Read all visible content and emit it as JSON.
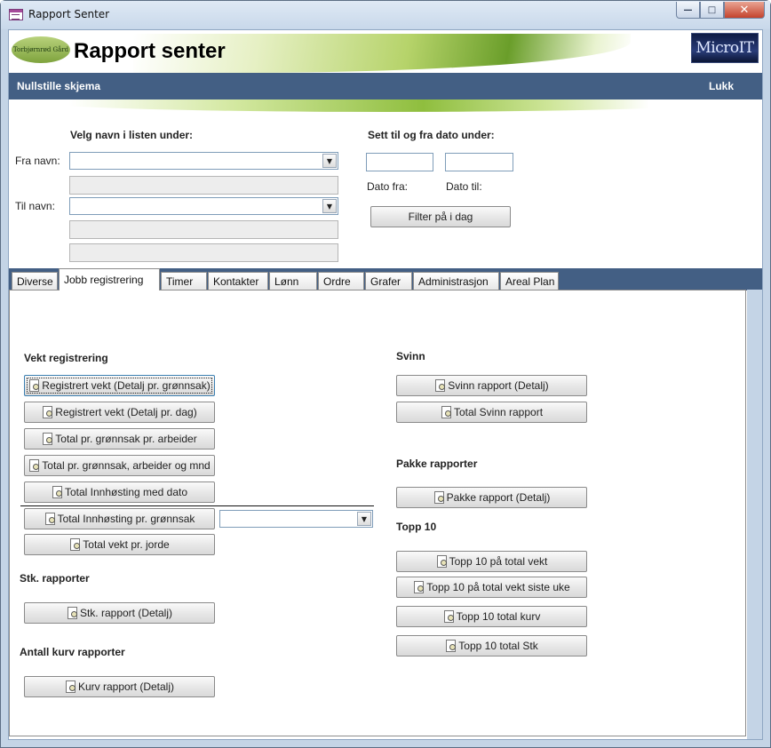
{
  "window": {
    "title": "Rapport Senter",
    "controls": {
      "minimize": "—",
      "maximize": "□",
      "close": "✕"
    }
  },
  "banner": {
    "title": "Rapport senter",
    "logo_text": "Torbjørnrød Gård",
    "brand_text": "MicroIT"
  },
  "nav": {
    "reset": "Nullstille skjema",
    "close": "Lukk"
  },
  "filters": {
    "names_heading": "Velg navn i listen under:",
    "from_name_label": "Fra navn:",
    "to_name_label": "Til navn:",
    "dates_heading": "Sett til og fra dato under:",
    "date_from_label": "Dato fra:",
    "date_to_label": "Dato til:",
    "today_button": "Filter på i dag"
  },
  "tabs": [
    {
      "label": "Diverse",
      "active": false
    },
    {
      "label": "Jobb registrering",
      "active": true
    },
    {
      "label": "Timer",
      "active": false
    },
    {
      "label": "Kontakter",
      "active": false
    },
    {
      "label": "Lønn",
      "active": false
    },
    {
      "label": "Ordre",
      "active": false
    },
    {
      "label": "Grafer",
      "active": false
    },
    {
      "label": "Administrasjon",
      "active": false
    },
    {
      "label": "Areal Plan",
      "active": false
    }
  ],
  "left_column": {
    "weight_heading": "Vekt registrering",
    "weight_buttons": [
      "Registrert vekt (Detalj pr. grønnsak)",
      "Registrert vekt (Detalj pr. dag)",
      "Total pr. grønnsak pr. arbeider",
      "Total pr. grønnsak, arbeider og mnd",
      "Total Innhøsting med dato",
      "Total Innhøsting pr. grønnsak",
      "Total vekt pr. jorde"
    ],
    "count_heading": "Stk. rapporter",
    "count_buttons": [
      "Stk. rapport (Detalj)"
    ],
    "basket_heading": "Antall kurv rapporter",
    "basket_buttons": [
      "Kurv rapport (Detalj)"
    ]
  },
  "right_column": {
    "waste_heading": "Svinn",
    "waste_buttons": [
      "Svinn rapport (Detalj)",
      "Total Svinn rapport"
    ],
    "package_heading": "Pakke rapporter",
    "package_buttons": [
      "Pakke rapport (Detalj)"
    ],
    "top10_heading": "Topp 10",
    "top10_buttons": [
      "Topp 10 på total vekt",
      "Topp 10 på total vekt siste uke",
      "Topp 10 total kurv",
      "Topp 10 total Stk"
    ]
  }
}
